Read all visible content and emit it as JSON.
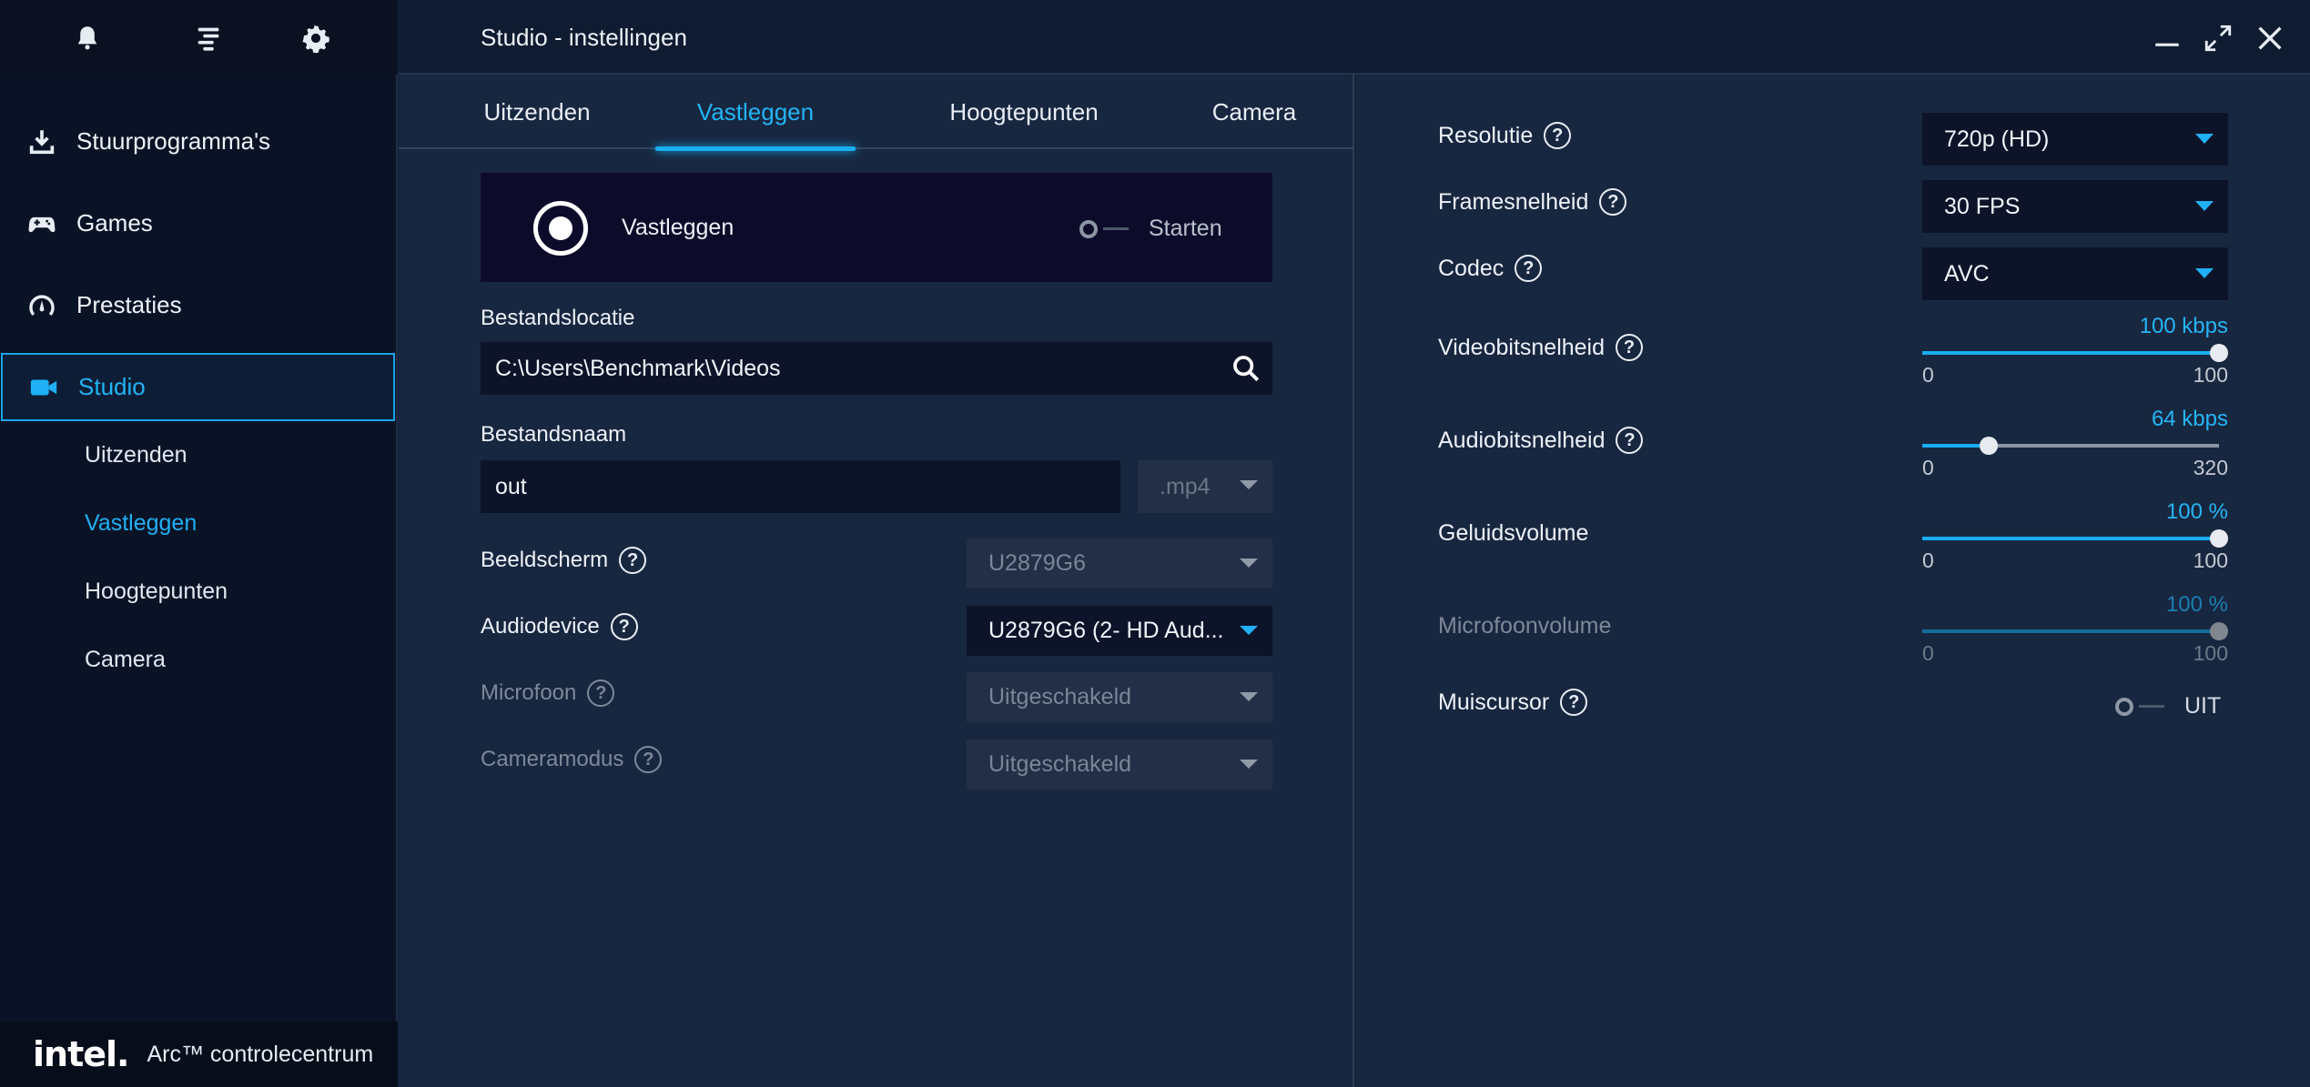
{
  "app": {
    "window_title": "Studio - instellingen",
    "brand_logo": "intel.",
    "brand_name": "Arc™ controlecentrum"
  },
  "sidebar": {
    "top_icons": [
      "bell-icon",
      "menu-icon",
      "gear-icon"
    ],
    "items": [
      {
        "label": "Stuurprogramma's",
        "icon": "download-icon"
      },
      {
        "label": "Games",
        "icon": "gamepad-icon"
      },
      {
        "label": "Prestaties",
        "icon": "gauge-icon"
      },
      {
        "label": "Studio",
        "icon": "camera-icon",
        "active": true
      }
    ],
    "sub_items": [
      {
        "label": "Uitzenden"
      },
      {
        "label": "Vastleggen",
        "active": true
      },
      {
        "label": "Hoogtepunten"
      },
      {
        "label": "Camera"
      }
    ]
  },
  "tabs": [
    {
      "label": "Uitzenden"
    },
    {
      "label": "Vastleggen",
      "active": true
    },
    {
      "label": "Hoogtepunten"
    },
    {
      "label": "Camera"
    }
  ],
  "capture": {
    "label": "Vastleggen",
    "toggle_label": "Starten",
    "toggle_on": false
  },
  "file": {
    "location_label": "Bestandslocatie",
    "location_value": "C:\\Users\\Benchmark\\Videos",
    "name_label": "Bestandsnaam",
    "name_value": "out",
    "extension": ".mp4"
  },
  "left_fields": {
    "display": {
      "label": "Beeldscherm",
      "value": "U2879G6"
    },
    "audio": {
      "label": "Audiodevice",
      "value": "U2879G6 (2- HD Aud..."
    },
    "mic": {
      "label": "Microfoon",
      "value": "Uitgeschakeld"
    },
    "camera": {
      "label": "Cameramodus",
      "value": "Uitgeschakeld"
    }
  },
  "right_fields": {
    "resolution": {
      "label": "Resolutie",
      "value": "720p (HD)"
    },
    "framerate": {
      "label": "Framesnelheid",
      "value": "30 FPS"
    },
    "codec": {
      "label": "Codec",
      "value": "AVC"
    },
    "video_bitrate": {
      "label": "Videobitsnelheid",
      "value_text": "100 kbps",
      "value": 100,
      "min": "0",
      "max": "100"
    },
    "audio_bitrate": {
      "label": "Audiobitsnelheid",
      "value_text": "64 kbps",
      "value": 64,
      "min": "0",
      "max": "320"
    },
    "volume": {
      "label": "Geluidsvolume",
      "value_text": "100 %",
      "value": 100,
      "min": "0",
      "max": "100"
    },
    "mic_volume": {
      "label": "Microfoonvolume",
      "value_text": "100 %",
      "value": 100,
      "min": "0",
      "max": "100",
      "disabled": true
    },
    "cursor": {
      "label": "Muiscursor",
      "toggle_label": "UIT",
      "toggle_on": false
    }
  },
  "colors": {
    "accent": "#1fb0f5",
    "background": "#182740",
    "sidebar": "#0a1326"
  }
}
